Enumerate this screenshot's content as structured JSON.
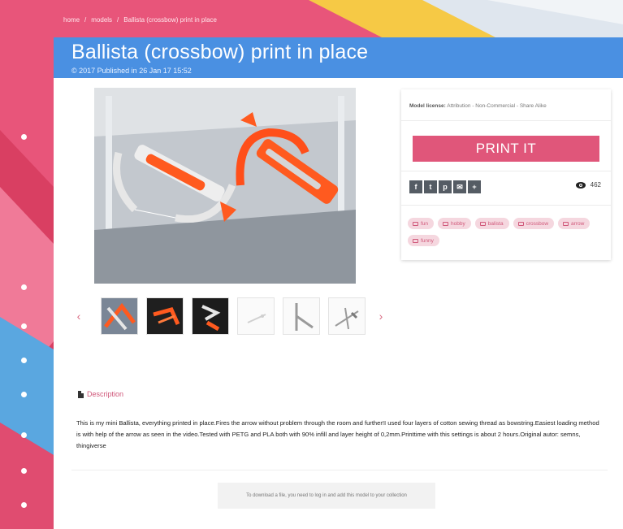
{
  "breadcrumb": {
    "home": "home",
    "sep1": "/",
    "models": "models",
    "sep2": "/",
    "current": "Ballista (crossbow) print in place"
  },
  "page": {
    "title": "Ballista (crossbow) print in place",
    "published": "© 2017 Published in 26 Jan 17 15:52"
  },
  "gallery": {
    "prev_arrow": "‹",
    "next_arrow": "›",
    "thumbnail_count": 6
  },
  "card": {
    "license_label": "Model license:",
    "license_value": "Attribution - Non-Commercial - Share Alike",
    "print_label": "PRINT IT",
    "share_buttons": [
      "f",
      "t",
      "p",
      "✉",
      "+"
    ],
    "views": "462",
    "tags": [
      "fun",
      "hobby",
      "balista",
      "crossbow",
      "arrow",
      "funny"
    ]
  },
  "description": {
    "heading": "Description",
    "text": "This is my mini Ballista, everything printed in place.Fires the arrow without problem through the room and further!I used four layers of cotton sewing thread as bowstring.Easiest loading method is with help of the arrow as seen in the video.Tested with PETG and PLA both with 90% infill and layer height of 0,2mm.Printtime with this settings is about 2 hours.Original autor: semns, thingiverse"
  },
  "download_note": "To download a file, you need to log in and add this model to your collection",
  "colors": {
    "accent_pink": "#e0567a",
    "title_blue": "#4a90e2",
    "tag_bg": "#f5d7df"
  }
}
